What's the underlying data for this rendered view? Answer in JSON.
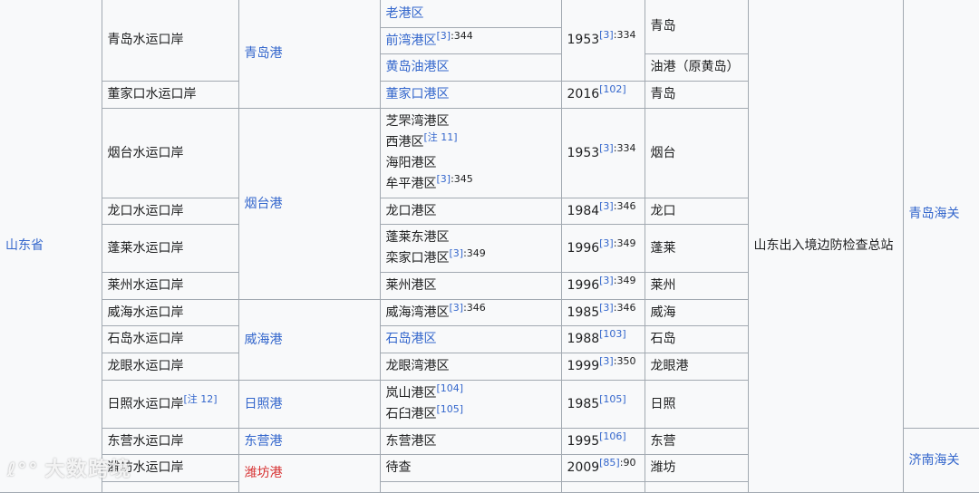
{
  "province": "山东省",
  "border_station": "山东出入境边防检查总站",
  "customs": [
    "青岛海关",
    "济南海关"
  ],
  "watermark": {
    "logo": "ℓ°°",
    "text": "大数跨境"
  },
  "colors": {
    "link": "#3366cc",
    "redlink": "#d73333",
    "border": "#a2a9b1",
    "background": "#f8f9fa"
  },
  "rows": [
    {
      "checkpoint": {
        "text": "青岛水运口岸"
      },
      "port": {
        "text": "青岛港",
        "link": "blue"
      },
      "areas": [
        {
          "text": "老港区",
          "link": true
        }
      ],
      "year": {
        "text": "1953",
        "ref": "[3]",
        "page": ":334"
      },
      "city": "青岛"
    },
    {
      "areas": [
        {
          "text": "前湾港区",
          "link": true,
          "ref": "[3]",
          "page": ":344"
        }
      ]
    },
    {
      "areas": [
        {
          "text": "黄岛油港区",
          "link": true
        }
      ],
      "city": "油港（原黄岛）"
    },
    {
      "checkpoint": {
        "text": "董家口水运口岸"
      },
      "areas": [
        {
          "text": "董家口港区",
          "link": true
        }
      ],
      "year": {
        "text": "2016",
        "ref": "[102]"
      },
      "city": "青岛"
    },
    {
      "checkpoint": {
        "text": "烟台水运口岸"
      },
      "port": {
        "text": "烟台港",
        "link": "blue"
      },
      "areas": [
        {
          "text": "芝罘湾港区"
        },
        {
          "text": "西港区",
          "ref": "[注 11]"
        },
        {
          "text": "海阳港区"
        },
        {
          "text": "牟平港区",
          "ref": "[3]",
          "page": ":345"
        }
      ],
      "year": {
        "text": "1953",
        "ref": "[3]",
        "page": ":334"
      },
      "city": "烟台"
    },
    {
      "checkpoint": {
        "text": "龙口水运口岸"
      },
      "areas": [
        {
          "text": "龙口港区"
        }
      ],
      "year": {
        "text": "1984",
        "ref": "[3]",
        "page": ":346"
      },
      "city": "龙口"
    },
    {
      "checkpoint": {
        "text": "蓬莱水运口岸"
      },
      "areas": [
        {
          "text": "蓬莱东港区"
        },
        {
          "text": "栾家口港区",
          "ref": "[3]",
          "page": ":349"
        }
      ],
      "year": {
        "text": "1996",
        "ref": "[3]",
        "page": ":349"
      },
      "city": "蓬莱"
    },
    {
      "checkpoint": {
        "text": "莱州水运口岸"
      },
      "areas": [
        {
          "text": "莱州港区"
        }
      ],
      "year": {
        "text": "1996",
        "ref": "[3]",
        "page": ":349"
      },
      "city": "莱州"
    },
    {
      "checkpoint": {
        "text": "威海水运口岸"
      },
      "port": {
        "text": "威海港",
        "link": "blue"
      },
      "areas": [
        {
          "text": "威海湾港区",
          "ref": "[3]",
          "page": ":346"
        }
      ],
      "year": {
        "text": "1985",
        "ref": "[3]",
        "page": ":346"
      },
      "city": "威海"
    },
    {
      "checkpoint": {
        "text": "石岛水运口岸"
      },
      "areas": [
        {
          "text": "石岛港区",
          "link": true
        }
      ],
      "year": {
        "text": "1988",
        "ref": "[103]"
      },
      "city": "石岛"
    },
    {
      "checkpoint": {
        "text": "龙眼水运口岸"
      },
      "areas": [
        {
          "text": "龙眼湾港区"
        }
      ],
      "year": {
        "text": "1999",
        "ref": "[3]",
        "page": ":350"
      },
      "city": "龙眼港"
    },
    {
      "checkpoint": {
        "text": "日照水运口岸",
        "ref": "[注 12]"
      },
      "port": {
        "text": "日照港",
        "link": "blue"
      },
      "areas": [
        {
          "text": "岚山港区",
          "ref": "[104]"
        },
        {
          "text": "石臼港区",
          "ref": "[105]"
        }
      ],
      "year": {
        "text": "1985",
        "ref": "[105]"
      },
      "city": "日照"
    },
    {
      "checkpoint": {
        "text": "东营水运口岸"
      },
      "port": {
        "text": "东营港",
        "link": "blue"
      },
      "areas": [
        {
          "text": "东营港区"
        }
      ],
      "year": {
        "text": "1995",
        "ref": "[106]"
      },
      "city": "东营"
    },
    {
      "checkpoint": {
        "text": "潍坊水运口岸"
      },
      "port": {
        "text": "潍坊港",
        "link": "red"
      },
      "areas": [
        {
          "text": "待查"
        }
      ],
      "year": {
        "text": "2009",
        "ref": "[85]",
        "page": ":90"
      },
      "city": "潍坊"
    }
  ]
}
